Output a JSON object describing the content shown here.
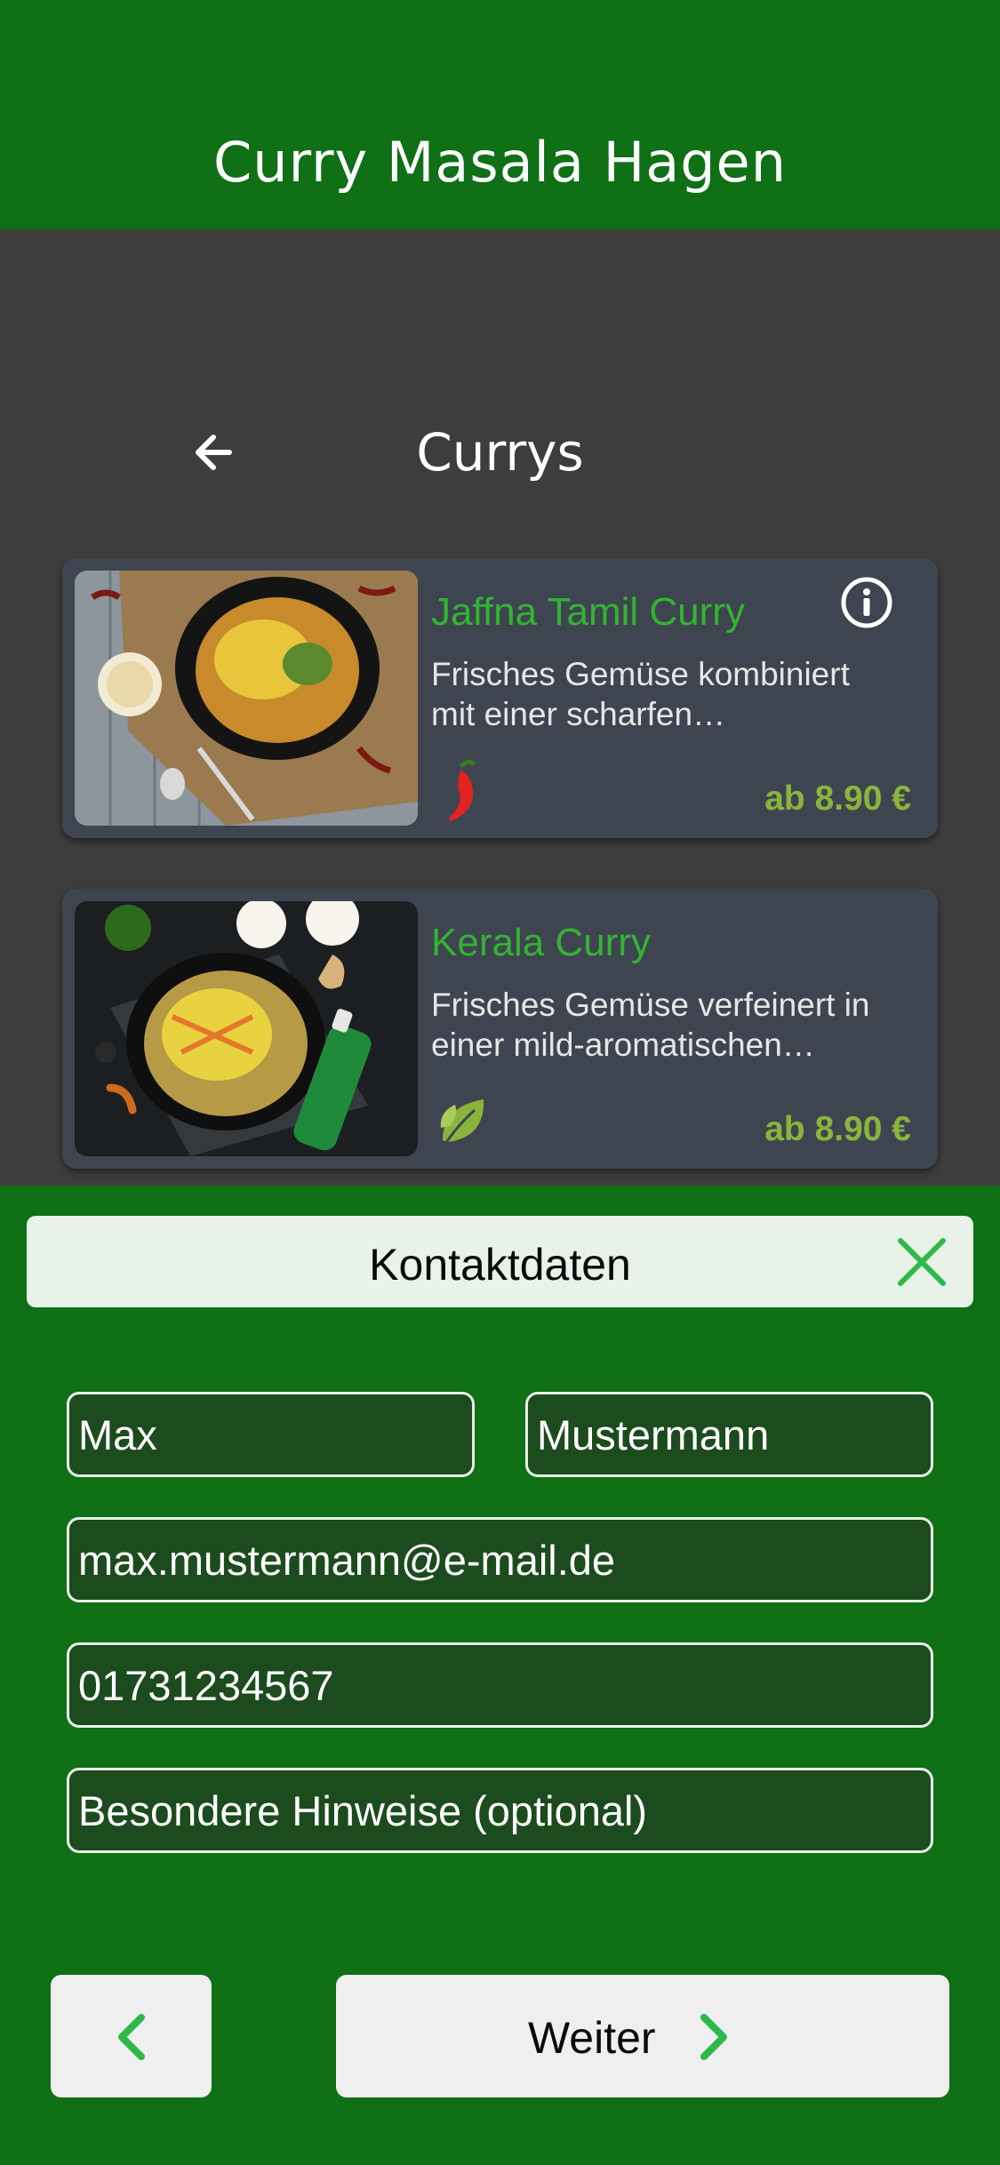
{
  "header": {
    "title": "Curry Masala Hagen"
  },
  "category": {
    "title": "Currys"
  },
  "products": [
    {
      "name": "Jaffna Tamil Curry",
      "description_line1": "Frisches Gemüse kombiniert",
      "description_line2": "mit einer scharfen…",
      "price": "ab 8.90 €",
      "badge": "chili-icon"
    },
    {
      "name": "Kerala Curry",
      "description_line1": "Frisches Gemüse verfeinert in",
      "description_line2": "einer mild-aromatischen…",
      "price": "ab 8.90 €",
      "badge": "leaf-icon"
    }
  ],
  "contact": {
    "title": "Kontaktdaten",
    "first_name": "Max",
    "last_name": "Mustermann",
    "email": "max.mustermann@e-mail.de",
    "phone": "01731234567",
    "notes_placeholder": "Besondere Hinweise (optional)",
    "next_label": "Weiter"
  },
  "colors": {
    "brand_green": "#0f7016",
    "accent_green": "#32b432",
    "price_green": "#8ab43c",
    "card_bg": "#3f4550",
    "field_bg": "#1c4b1e"
  }
}
